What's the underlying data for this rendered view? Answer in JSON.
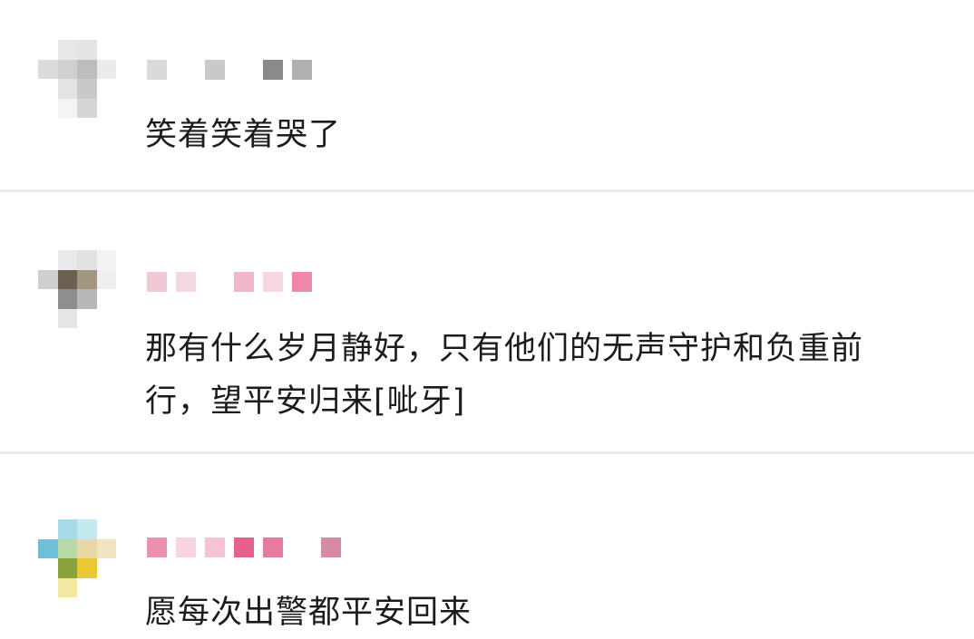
{
  "comments": [
    {
      "username_mosaic": [
        "#d9d9d9",
        "#ffffff",
        "#c9c9c9",
        "#ffffff",
        "#8a8a8a",
        "#b0b0b0"
      ],
      "avatar_mosaic": [
        "#ffffff",
        "#e8e8e8",
        "#e4e4e4",
        "#ffffff",
        "#dcdcdc",
        "#d0d0d0",
        "#bdbdbd",
        "#ebebeb",
        "#ffffff",
        "#e3e3e3",
        "#c9c9c9",
        "#ffffff",
        "#ffffff",
        "#f4f4f4",
        "#d6d6d6",
        "#ffffff"
      ],
      "text": "笑着笑着哭了"
    },
    {
      "username_mosaic": [
        "#f0c9d3",
        "#f5d9e0",
        "#ffffff",
        "#f2b7c8",
        "#f7d7e0",
        "#ee87a8"
      ],
      "avatar_mosaic": [
        "#ffffff",
        "#eaeaea",
        "#e2e2e2",
        "#f3f3f3",
        "#cfcfcf",
        "#6b6052",
        "#a39783",
        "#efefef",
        "#ffffff",
        "#8e8e8e",
        "#b8b8b8",
        "#ffffff",
        "#ffffff",
        "#e6e6e6",
        "#ffffff",
        "#ffffff"
      ],
      "text": "那有什么岁月静好，只有他们的无声守护和负重前行，望平安归来[呲牙]"
    },
    {
      "username_mosaic": [
        "#ec8fb0",
        "#f8d4e0",
        "#f6c2d4",
        "#e5608d",
        "#e77b9e",
        "#ffffff",
        "#d98aa6"
      ],
      "avatar_mosaic": [
        "#ffffff",
        "#a8dbe8",
        "#c4e8f0",
        "#ffffff",
        "#6cc0d8",
        "#b9d9a8",
        "#e8d8a6",
        "#f0e5c0",
        "#ffffff",
        "#8aa23c",
        "#e9c834",
        "#ffffff",
        "#ffffff",
        "#f3e9a3",
        "#ffffff",
        "#ffffff"
      ],
      "text": "愿每次出警都平安回来"
    }
  ]
}
